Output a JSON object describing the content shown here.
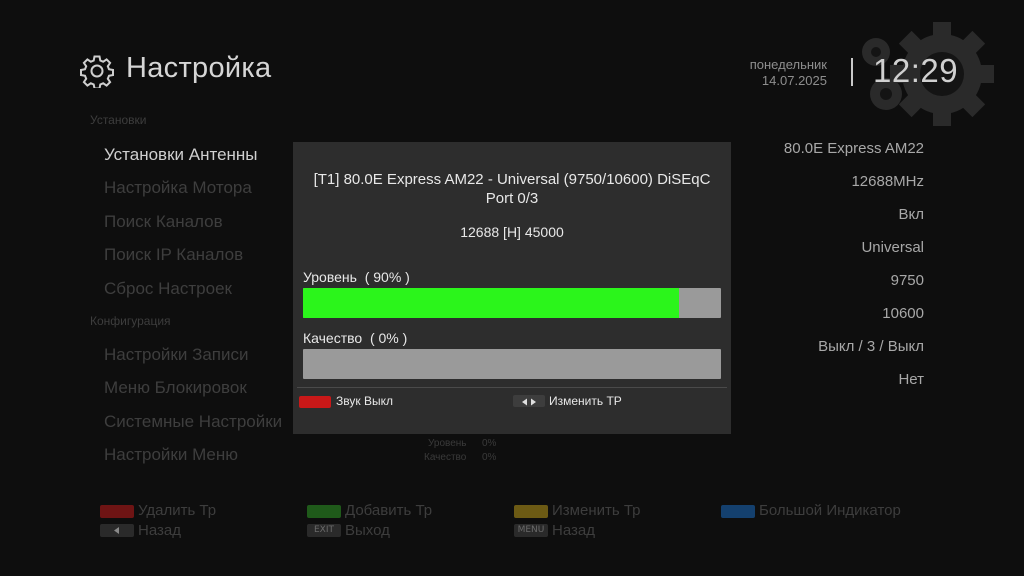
{
  "header": {
    "title": "Настройка",
    "weekday": "понедельник",
    "date": "14.07.2025",
    "time": "12:29"
  },
  "menu": {
    "section_install": "Установки",
    "section_config": "Конфигурация",
    "items_install": [
      "Установки Антенны",
      "Настройка Мотора",
      "Поиск Каналов",
      "Поиск IP Каналов",
      "Сброс Настроек"
    ],
    "items_config": [
      "Настройки Записи",
      "Меню Блокировок",
      "Системные Настройки",
      "Настройки Меню"
    ]
  },
  "values": [
    "80.0E Express AM22",
    "12688MHz",
    "Вкл",
    "Universal",
    "9750",
    "10600",
    "Выкл / 3 / Выкл",
    "Нет"
  ],
  "mini_stats": {
    "level_label": "Уровень",
    "level_value": "0%",
    "quality_label": "Качество",
    "quality_value": "0%"
  },
  "dialog": {
    "title": "[T1] 80.0E Express AM22 - Universal (9750/10600) DiSEqC Port 0/3",
    "freq": "12688 [H] 45000",
    "level_label": "Уровень  ( 90% )",
    "level_fraction": 0.9,
    "quality_label": "Качество  ( 0% )",
    "quality_fraction": 0.0,
    "hint_red": "Звук Выкл",
    "hint_arrows": "Изменить TP",
    "colors": {
      "level": "#2bf51b",
      "bar_bg": "#9a9a9a",
      "red": "#c91818"
    }
  },
  "footer": {
    "red": "Удалить Тр",
    "green": "Добавить Тр",
    "yellow": "Изменить Тр",
    "blue": "Большой Индикатор",
    "back_left": "Назад",
    "exit_key": "EXIT",
    "exit": "Выход",
    "menu_key": "MENU",
    "back_menu": "Назад",
    "colors": {
      "red": "#6e1414",
      "green": "#1f5a1a",
      "yellow": "#6c5a14",
      "blue": "#14406e"
    }
  }
}
